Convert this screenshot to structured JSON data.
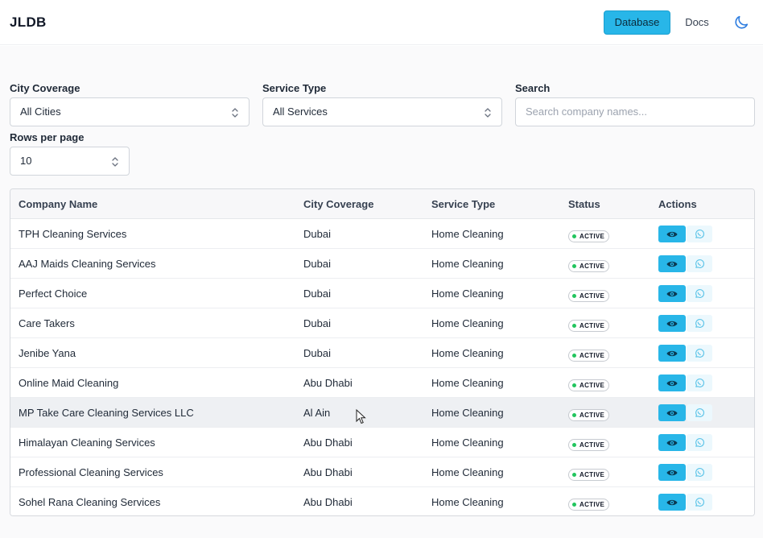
{
  "app": {
    "brand": "JLDB"
  },
  "nav": {
    "database_label": "Database",
    "docs_label": "Docs"
  },
  "filters": {
    "city_label": "City Coverage",
    "city_value": "All Cities",
    "service_label": "Service Type",
    "service_value": "All Services",
    "search_label": "Search",
    "search_placeholder": "Search company names...",
    "rows_label": "Rows per page",
    "rows_value": "10"
  },
  "table": {
    "headers": [
      "Company Name",
      "City Coverage",
      "Service Type",
      "Status",
      "Actions"
    ],
    "rows": [
      {
        "company": "TPH Cleaning Services",
        "city": "Dubai",
        "service": "Home Cleaning",
        "status": "ACTIVE"
      },
      {
        "company": "AAJ Maids Cleaning Services",
        "city": "Dubai",
        "service": "Home Cleaning",
        "status": "ACTIVE"
      },
      {
        "company": "Perfect Choice",
        "city": "Dubai",
        "service": "Home Cleaning",
        "status": "ACTIVE"
      },
      {
        "company": "Care Takers",
        "city": "Dubai",
        "service": "Home Cleaning",
        "status": "ACTIVE"
      },
      {
        "company": "Jenibe Yana",
        "city": "Dubai",
        "service": "Home Cleaning",
        "status": "ACTIVE"
      },
      {
        "company": "Online Maid Cleaning",
        "city": "Abu Dhabi",
        "service": "Home Cleaning",
        "status": "ACTIVE"
      },
      {
        "company": "MP Take Care Cleaning Services LLC",
        "city": "Al Ain",
        "service": "Home Cleaning",
        "status": "ACTIVE"
      },
      {
        "company": "Himalayan Cleaning Services",
        "city": "Abu Dhabi",
        "service": "Home Cleaning",
        "status": "ACTIVE"
      },
      {
        "company": "Professional Cleaning Services",
        "city": "Abu Dhabi",
        "service": "Home Cleaning",
        "status": "ACTIVE"
      },
      {
        "company": "Sohel Rana Cleaning Services",
        "city": "Abu Dhabi",
        "service": "Home Cleaning",
        "status": "ACTIVE"
      }
    ]
  },
  "icons": {
    "theme": "moon-icon",
    "select": "chevron-up-down-icon",
    "view": "eye-icon",
    "contact": "whatsapp-icon"
  },
  "colors": {
    "accent": "#28b6e8",
    "status_dot": "#22c55e",
    "whatsapp_bg": "#ecf8fd"
  }
}
